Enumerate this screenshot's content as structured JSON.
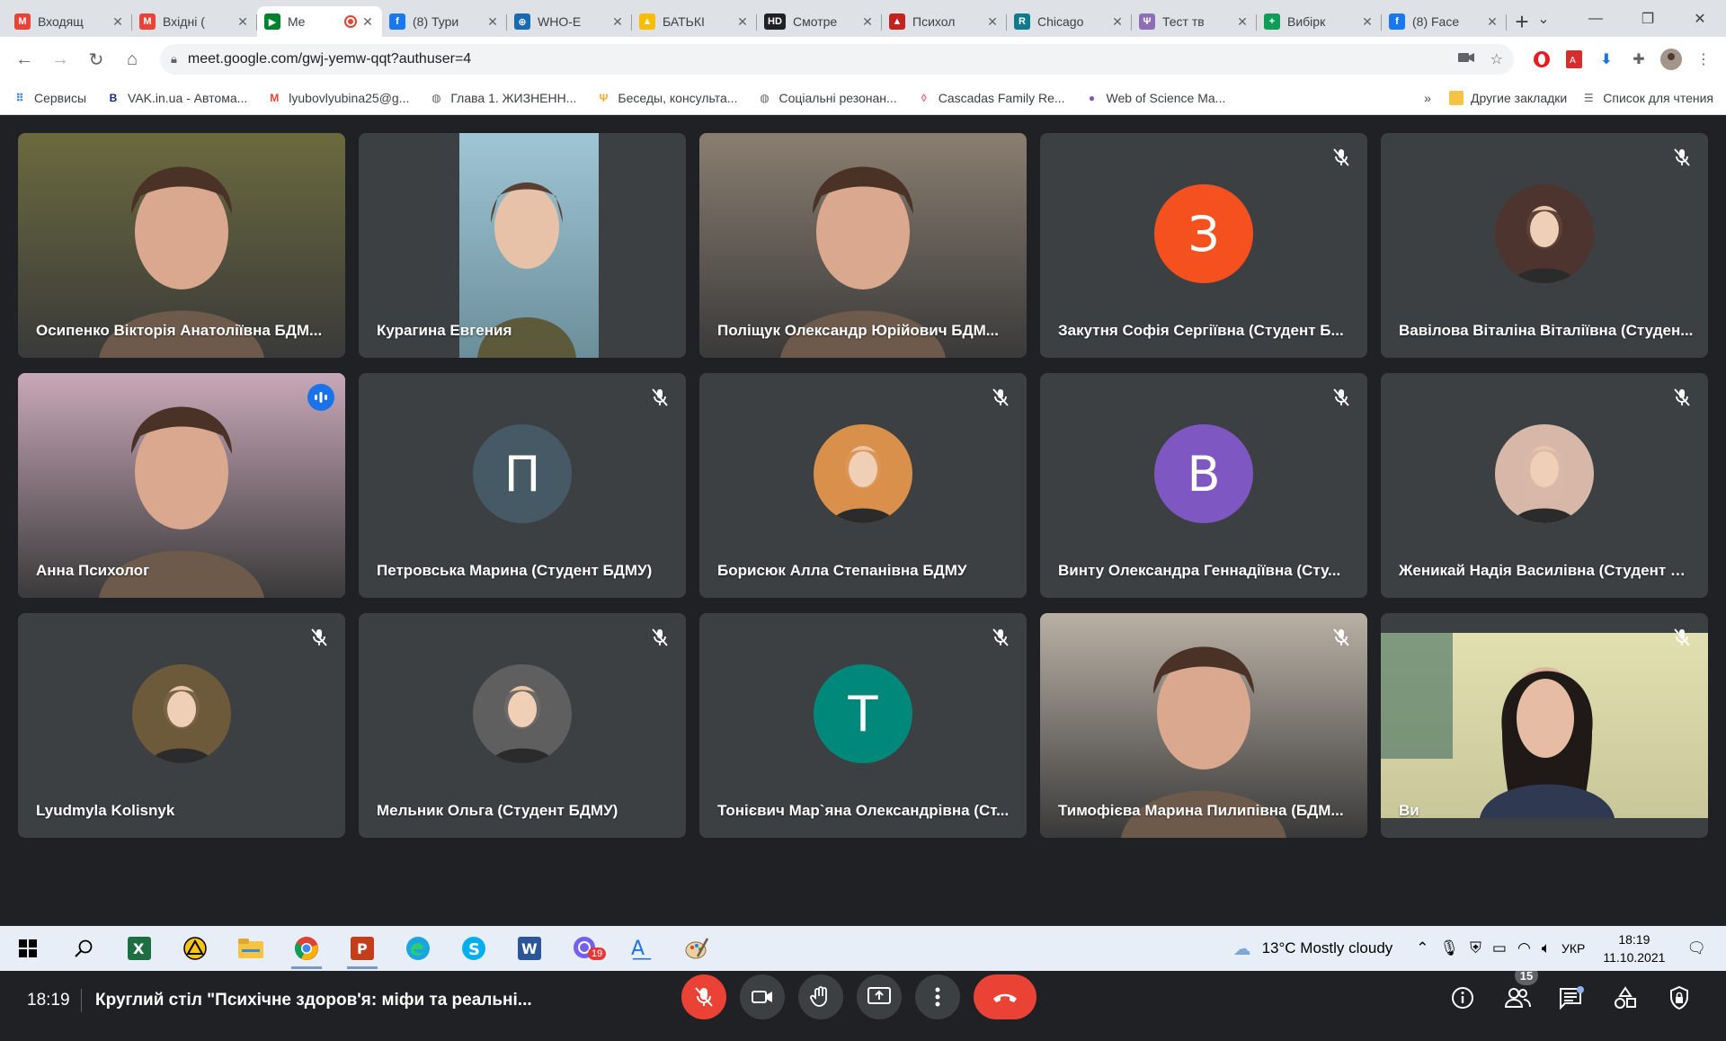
{
  "tabs": [
    {
      "title": "Входящ",
      "icon": "gmail-icon",
      "color": "#ea4335",
      "glyph": "M",
      "active": false
    },
    {
      "title": "Вхідні (",
      "icon": "gmail-icon",
      "color": "#ea4335",
      "glyph": "M",
      "active": false
    },
    {
      "title": "Me",
      "icon": "meet-icon",
      "color": "#00832d",
      "glyph": "▶",
      "active": true,
      "recording": true
    },
    {
      "title": "(8) Тури",
      "icon": "facebook-icon",
      "color": "#1877f2",
      "glyph": "f",
      "active": false
    },
    {
      "title": "WHO-E",
      "icon": "who-icon",
      "color": "#1a6ab2",
      "glyph": "⊕",
      "active": false
    },
    {
      "title": "БАТЬКІ",
      "icon": "drive-icon",
      "color": "#fbbc04",
      "glyph": "▲",
      "active": false
    },
    {
      "title": "Смотре",
      "icon": "hd-icon",
      "color": "#202124",
      "glyph": "HD",
      "active": false
    },
    {
      "title": "Психол",
      "icon": "graduation-icon",
      "color": "#c5221f",
      "glyph": "▲",
      "active": false
    },
    {
      "title": "Chicago",
      "icon": "chicago-icon",
      "color": "#0f7b8c",
      "glyph": "R",
      "active": false
    },
    {
      "title": "Тест тв",
      "icon": "test-icon",
      "color": "#8e6fb5",
      "glyph": "Ψ",
      "active": false
    },
    {
      "title": "Вибірк",
      "icon": "sheets-icon",
      "color": "#0f9d58",
      "glyph": "+",
      "active": false
    },
    {
      "title": "(8) Face",
      "icon": "facebook-icon",
      "color": "#1877f2",
      "glyph": "f",
      "active": false
    }
  ],
  "toolbar": {
    "url": "meet.google.com/gwj-yemw-qqt?authuser=4"
  },
  "bookmarks": [
    {
      "label": "Сервисы",
      "icon": "apps-icon",
      "color": "#4285f4",
      "glyph": "⠿"
    },
    {
      "label": "VAK.in.ua - Автома...",
      "icon": "vak-icon",
      "color": "#1a237e",
      "glyph": "B"
    },
    {
      "label": "lyubovlyubina25@g...",
      "icon": "gmail-icon",
      "color": "#ea4335",
      "glyph": "M"
    },
    {
      "label": "Глава 1. ЖИЗНЕНН...",
      "icon": "globe-icon",
      "color": "#5f6368",
      "glyph": "◍"
    },
    {
      "label": "Беседы, консульта...",
      "icon": "psy-icon",
      "color": "#f9a825",
      "glyph": "Ψ"
    },
    {
      "label": "Соціальні резонан...",
      "icon": "globe-icon",
      "color": "#5f6368",
      "glyph": "◍"
    },
    {
      "label": "Cascadas Family Re...",
      "icon": "airbnb-icon",
      "color": "#ff5a5f",
      "glyph": "◊"
    },
    {
      "label": "Web of Science Ma...",
      "icon": "wos-icon",
      "color": "#7b5ea7",
      "glyph": "●"
    }
  ],
  "bookmarks_right": {
    "more": "»",
    "other": "Другие закладки",
    "reading": "Список для чтения"
  },
  "participants": [
    {
      "name": "Осипенко Вікторія Анатоліївна БДМ...",
      "type": "video",
      "muted": false,
      "bg": "#6b6a3e"
    },
    {
      "name": "Курагина Евгения",
      "type": "video-narrow",
      "muted": false,
      "bg": "#7aa6b8"
    },
    {
      "name": "Поліщук Олександр Юрійович БДМ...",
      "type": "video",
      "muted": false,
      "bg": "#8a7e70"
    },
    {
      "name": "Закутня Софія Сергіївна (Студент Б...",
      "type": "letter",
      "letter": "З",
      "color": "#f4511e",
      "muted": true
    },
    {
      "name": "Вавілова Віталіна Віталіївна (Студен...",
      "type": "photo",
      "color": "#4e342e",
      "muted": true
    },
    {
      "name": "Анна Психолог",
      "type": "video",
      "muted": false,
      "speaking": true,
      "bg": "#c8a8b8"
    },
    {
      "name": "Петровська Марина (Студент БДМУ)",
      "type": "letter",
      "letter": "П",
      "color": "#455a64",
      "muted": true
    },
    {
      "name": "Борисюк Алла Степанівна БДМУ",
      "type": "photo",
      "color": "#d9904a",
      "muted": true
    },
    {
      "name": "Винту Олександра Геннадіївна (Сту...",
      "type": "letter",
      "letter": "В",
      "color": "#7e57c2",
      "muted": true
    },
    {
      "name": "Женикай Надія Василівна (Студент Б...",
      "type": "photo",
      "color": "#d7b8a8",
      "muted": true
    },
    {
      "name": "Lyudmyla Kolisnyk",
      "type": "photo",
      "color": "#6d5a3a",
      "muted": true
    },
    {
      "name": "Мельник Ольга (Студент БДМУ)",
      "type": "photo",
      "color": "#5f5f5f",
      "muted": true
    },
    {
      "name": "Тонієвич Мар`яна Олександрівна (Ст...",
      "type": "letter",
      "letter": "Т",
      "color": "#00897b",
      "muted": true
    },
    {
      "name": "Тимофієва Марина Пилипівна (БДМ...",
      "type": "video",
      "muted": true,
      "bg": "#b9b0a4"
    },
    {
      "name": "Ви",
      "type": "video-self",
      "muted": true,
      "bg": "#d8d7a8"
    }
  ],
  "bottom": {
    "time": "18:19",
    "title": "Круглий стіл \"Психічне здоров'я: міфи та реальні...",
    "participant_count": "15"
  },
  "taskbar": {
    "weather": "13°C  Mostly cloudy",
    "lang": "УКР",
    "time": "18:19",
    "date": "11.10.2021",
    "viber_badge": "19"
  }
}
